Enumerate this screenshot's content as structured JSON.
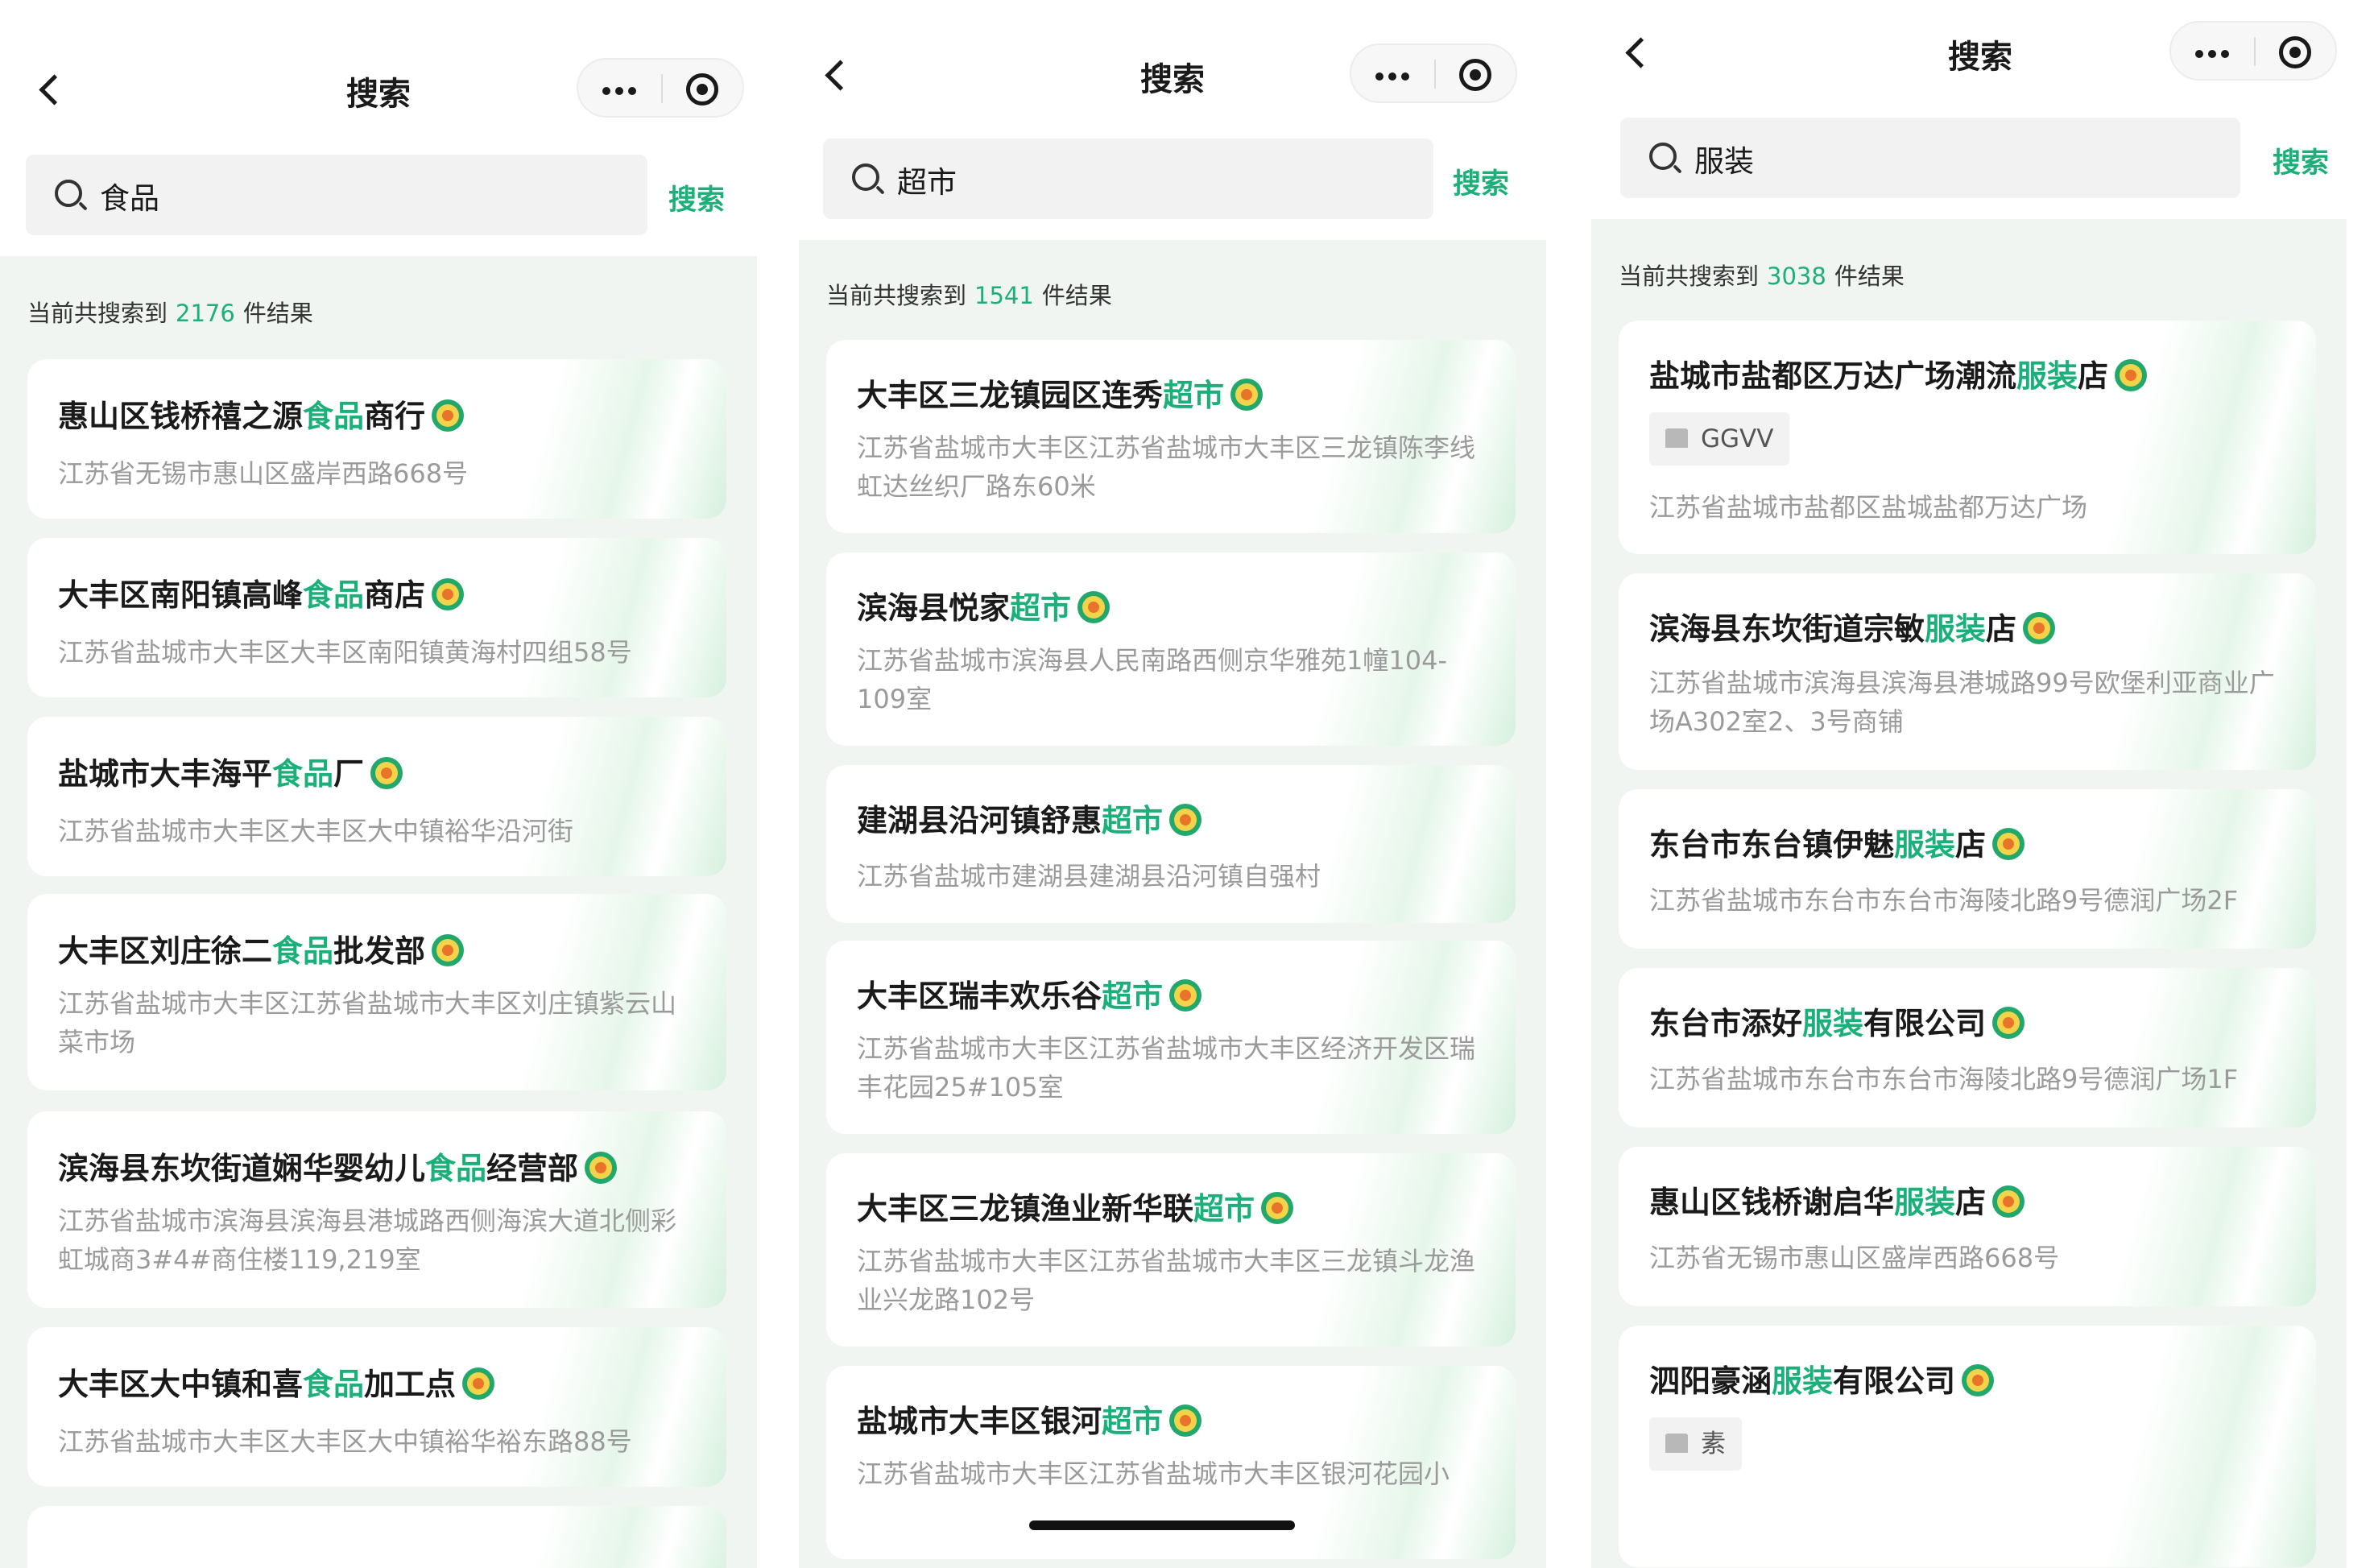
{
  "panels": [
    {
      "nav_title": "搜索",
      "search_value": "食品",
      "search_button": "搜索",
      "count_prefix": "当前共搜索到",
      "count": "2176",
      "count_suffix": "件结果",
      "results": [
        {
          "before": "惠山区钱桥禧之源",
          "hl": "食品",
          "after": "商行",
          "address": "江苏省无锡市惠山区盛岸西路668号"
        },
        {
          "before": "大丰区南阳镇高峰",
          "hl": "食品",
          "after": "商店",
          "address": "江苏省盐城市大丰区大丰区南阳镇黄海村四组58号"
        },
        {
          "before": "盐城市大丰海平",
          "hl": "食品",
          "after": "厂",
          "address": "江苏省盐城市大丰区大丰区大中镇裕华沿河街"
        },
        {
          "before": "大丰区刘庄徐二",
          "hl": "食品",
          "after": "批发部",
          "address": "江苏省盐城市大丰区江苏省盐城市大丰区刘庄镇紫云山菜市场"
        },
        {
          "before": "滨海县东坎街道娴华婴幼儿",
          "hl": "食品",
          "after": "经营部",
          "address": "江苏省盐城市滨海县滨海县港城路西侧海滨大道北侧彩虹城商3#4#商住楼119,219室"
        },
        {
          "before": "大丰区大中镇和喜",
          "hl": "食品",
          "after": "加工点",
          "address": "江苏省盐城市大丰区大丰区大中镇裕华裕东路88号"
        }
      ]
    },
    {
      "nav_title": "搜索",
      "search_value": "超市",
      "search_button": "搜索",
      "count_prefix": "当前共搜索到",
      "count": "1541",
      "count_suffix": "件结果",
      "results": [
        {
          "before": "大丰区三龙镇园区连秀",
          "hl": "超市",
          "after": "",
          "address": "江苏省盐城市大丰区江苏省盐城市大丰区三龙镇陈李线虹达丝织厂路东60米"
        },
        {
          "before": "滨海县悦家",
          "hl": "超市",
          "after": "",
          "address": "江苏省盐城市滨海县人民南路西侧京华雅苑1幢104-109室"
        },
        {
          "before": "建湖县沿河镇舒惠",
          "hl": "超市",
          "after": "",
          "address": "江苏省盐城市建湖县建湖县沿河镇自强村"
        },
        {
          "before": "大丰区瑞丰欢乐谷",
          "hl": "超市",
          "after": "",
          "address": "江苏省盐城市大丰区江苏省盐城市大丰区经济开发区瑞丰花园25#105室"
        },
        {
          "before": "大丰区三龙镇渔业新华联",
          "hl": "超市",
          "after": "",
          "address": "江苏省盐城市大丰区江苏省盐城市大丰区三龙镇斗龙渔业兴龙路102号"
        },
        {
          "before": "盐城市大丰区银河",
          "hl": "超市",
          "after": "",
          "address": "江苏省盐城市大丰区江苏省盐城市大丰区银河花园小"
        }
      ]
    },
    {
      "nav_title": "搜索",
      "search_value": "服装",
      "search_button": "搜索",
      "count_prefix": "当前共搜索到",
      "count": "3038",
      "count_suffix": "件结果",
      "results": [
        {
          "before": "盐城市盐都区万达广场潮流",
          "hl": "服装",
          "after": "店",
          "tag": "GGVV",
          "address": "江苏省盐城市盐都区盐城盐都万达广场"
        },
        {
          "before": "滨海县东坎街道宗敏",
          "hl": "服装",
          "after": "店",
          "address": "江苏省盐城市滨海县滨海县港城路99号欧堡利亚商业广场A302室2、3号商铺"
        },
        {
          "before": "东台市东台镇伊魅",
          "hl": "服装",
          "after": "店",
          "address": "江苏省盐城市东台市东台市海陵北路9号德润广场2F"
        },
        {
          "before": "东台市添好",
          "hl": "服装",
          "after": "有限公司",
          "address": "江苏省盐城市东台市东台市海陵北路9号德润广场1F"
        },
        {
          "before": "惠山区钱桥谢启华",
          "hl": "服装",
          "after": "店",
          "address": "江苏省无锡市惠山区盛岸西路668号"
        },
        {
          "before": "泗阳豪涵",
          "hl": "服装",
          "after": "有限公司",
          "tag": "素",
          "address": ""
        }
      ]
    }
  ],
  "colors": {
    "accent": "#1bb07a",
    "result_bg": "#f0f5f2",
    "address": "#9a9a9a"
  },
  "icons": [
    "back-icon",
    "more-icon",
    "target-icon",
    "search-icon",
    "verified-badge-icon",
    "shop-icon"
  ]
}
